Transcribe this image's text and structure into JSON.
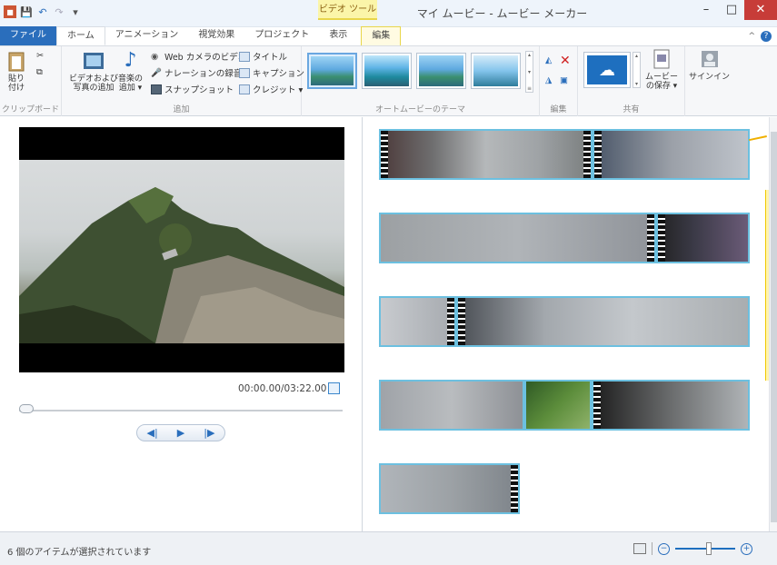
{
  "window": {
    "title": "マイ ムービー - ムービー メーカー",
    "context_tab": "ビデオ ツール"
  },
  "tabs": [
    "ファイル",
    "ホーム",
    "アニメーション",
    "視覚効果",
    "プロジェクト",
    "表示",
    "編集"
  ],
  "ribbon": {
    "clipboard": {
      "label": "クリップボード",
      "paste": "貼り\n付け"
    },
    "add": {
      "label": "追加",
      "add_media": "ビデオおよび\n写真の追加",
      "add_music": "音楽の\n追加 ▾",
      "webcam": "Web カメラのビデオ",
      "narration": "ナレーションの録音 ▾",
      "snapshot": "スナップショット",
      "title": "タイトル",
      "caption": "キャプション",
      "credits": "クレジット ▾"
    },
    "themes": {
      "label": "オートムービーのテーマ"
    },
    "edit": {
      "label": "編集"
    },
    "share": {
      "label": "共有",
      "save_movie": "ムービー\nの保存 ▾",
      "sign_in": "サインイン"
    }
  },
  "preview": {
    "time": "00:00.00/03:22.00"
  },
  "status": {
    "text": "6 個のアイテムが選択されています"
  },
  "colors": {
    "file_tab": "#2a6ebc",
    "selection": "#6cc0e0",
    "context": "#fbf5a9"
  }
}
